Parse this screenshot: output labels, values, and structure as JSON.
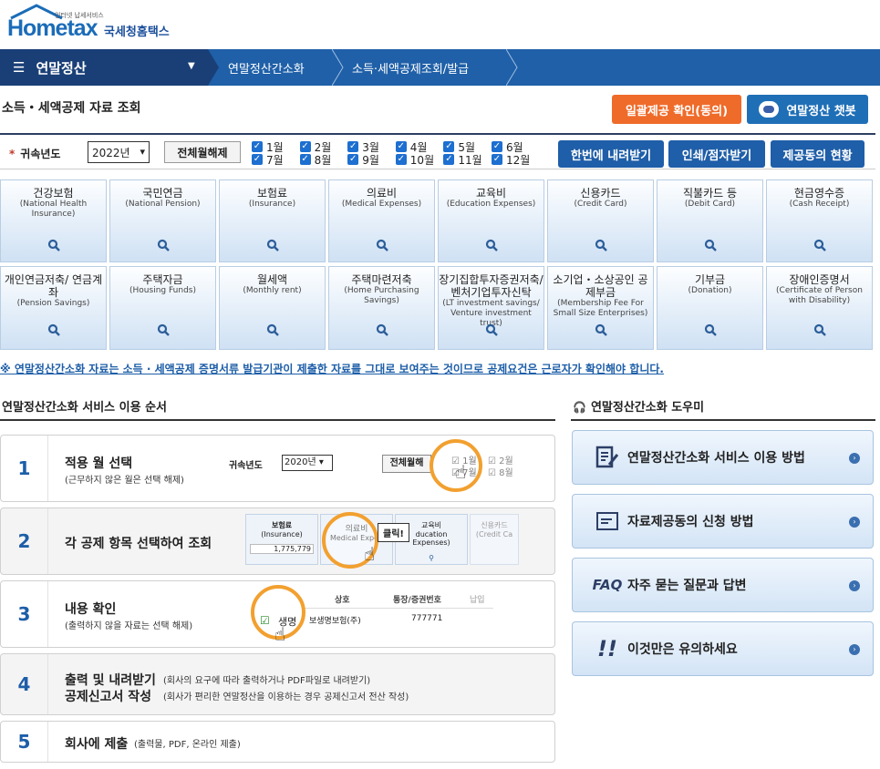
{
  "logo": {
    "wordmark": "Hometax",
    "tagline": "인터넷 납세서비스",
    "kr_name": "국세청홈택스"
  },
  "nav": {
    "menu_label": "연말정산",
    "crumbs": [
      "연말정산간소화",
      "소득·세액공제조회/발급"
    ],
    "colors": {
      "bar": "#1f60a8",
      "menu": "#1a3f77"
    }
  },
  "page": {
    "title": "소득・세액공제 자료 조회",
    "btn_consent": "일괄제공 확인(동의)",
    "btn_chatbot": "연말정산 챗봇"
  },
  "filter": {
    "year_label": "귀속년도",
    "year_value": "2022년",
    "clear_label": "전체월해제",
    "months": [
      "1월",
      "2월",
      "3월",
      "4월",
      "5월",
      "6월",
      "7월",
      "8월",
      "9월",
      "10월",
      "11월",
      "12월"
    ],
    "months_checked": [
      true,
      true,
      true,
      true,
      true,
      true,
      true,
      true,
      true,
      true,
      true,
      true
    ],
    "btn_download": "한번에 내려받기",
    "btn_print": "인쇄/점자받기",
    "btn_status": "제공동의 현황"
  },
  "tiles": [
    {
      "t": "건강보험",
      "s": "(National Health Insurance)",
      "icon": "search-icon"
    },
    {
      "t": "국민연금",
      "s": "(National Pension)",
      "icon": "search-icon"
    },
    {
      "t": "보험료",
      "s": "(Insurance)",
      "icon": "search-icon"
    },
    {
      "t": "의료비",
      "s": "(Medical Expenses)",
      "icon": "search-icon"
    },
    {
      "t": "교육비",
      "s": "(Education Expenses)",
      "icon": "search-icon"
    },
    {
      "t": "신용카드",
      "s": "(Credit Card)",
      "icon": "search-icon"
    },
    {
      "t": "직불카드 등",
      "s": "(Debit Card)",
      "icon": "search-icon"
    },
    {
      "t": "현금영수증",
      "s": "(Cash Receipt)",
      "icon": "search-icon"
    },
    {
      "t": "개인연금저축/ 연금계좌",
      "s": "(Pension Savings)",
      "icon": "search-icon"
    },
    {
      "t": "주택자금",
      "s": "(Housing Funds)",
      "icon": "search-icon"
    },
    {
      "t": "월세액",
      "s": "(Monthly rent)",
      "icon": "search-icon"
    },
    {
      "t": "주택마련저축",
      "s": "(Home Purchasing Savings)",
      "icon": "search-icon"
    },
    {
      "t": "장기집합투자증권저축/ 벤처기업투자신탁",
      "s": "(LT investment savings/ Venture investment trust)",
      "icon": "search-icon"
    },
    {
      "t": "소기업・소상공인 공제부금",
      "s": "(Membership Fee For Small Size Enterprises)",
      "icon": "search-icon"
    },
    {
      "t": "기부금",
      "s": "(Donation)",
      "icon": "search-icon"
    },
    {
      "t": "장애인증명서",
      "s": "(Certificate of Person with Disability)",
      "icon": "search-icon"
    }
  ],
  "notice": "※ 연말정산간소화 자료는 소득 · 세액공제 증명서류 발급기관이 제출한 자료를 그대로 보여주는 것이므로 공제요건은 근로자가 확인해야 합니다.",
  "steps": {
    "title": "연말정산간소화 서비스 이용 순서",
    "items": [
      {
        "num": "1",
        "title": "적용 월 선택",
        "sub": "(근무하지 않은 월은 선택 해제)"
      },
      {
        "num": "2",
        "title": "각 공제 항목 선택하여 조회",
        "sub": ""
      },
      {
        "num": "3",
        "title": "내용 확인",
        "sub": "(출력하지 않을 자료는 선택 해제)"
      },
      {
        "num": "4",
        "title": "출력 및 내려받기",
        "title2": "공제신고서 작성",
        "sub": "(회사의 요구에 따라 출력하거나 PDF파일로 내려받기)",
        "sub2": "(회사가 편리한 연말정산을 이용하는 경우 공제신고서 전산 작성)"
      },
      {
        "num": "5",
        "title": "회사에 제출",
        "sub": "(출력물, PDF, 온라인 제출)"
      }
    ],
    "illus1": {
      "label": "귀속년도",
      "year": "2020년",
      "btn": "전체월해",
      "m1": "1월",
      "m2": "2월",
      "m7": "7월",
      "m8": "8월"
    },
    "illus2": {
      "t1": "보험료",
      "s1": "(Insurance)",
      "v1": "1,775,779",
      "t2": "의료비",
      "s2": "Medical Expen",
      "click": "클릭!",
      "t3": "교육비",
      "s3": "ducation Expenses)",
      "t4": "신용카드",
      "s4": "(Credit Ca"
    },
    "illus3": {
      "h1": "상호",
      "h2": "통장/증권번호",
      "h3": "납입",
      "r1": "생명",
      "r1b": "보생명보험(주)",
      "r1c": "777771"
    }
  },
  "helper": {
    "title": "연말정산간소화 도우미",
    "items": [
      {
        "label": "연말정산간소화 서비스 이용 방법",
        "icon": "document-pen-icon"
      },
      {
        "label": "자료제공동의 신청 방법",
        "icon": "document-icon"
      },
      {
        "label": "자주 묻는 질문과 답변",
        "icon": "faq-icon",
        "icon_text": "FAQ"
      },
      {
        "label": "이것만은 유의하세요",
        "icon": "exclamation-icon"
      }
    ]
  }
}
